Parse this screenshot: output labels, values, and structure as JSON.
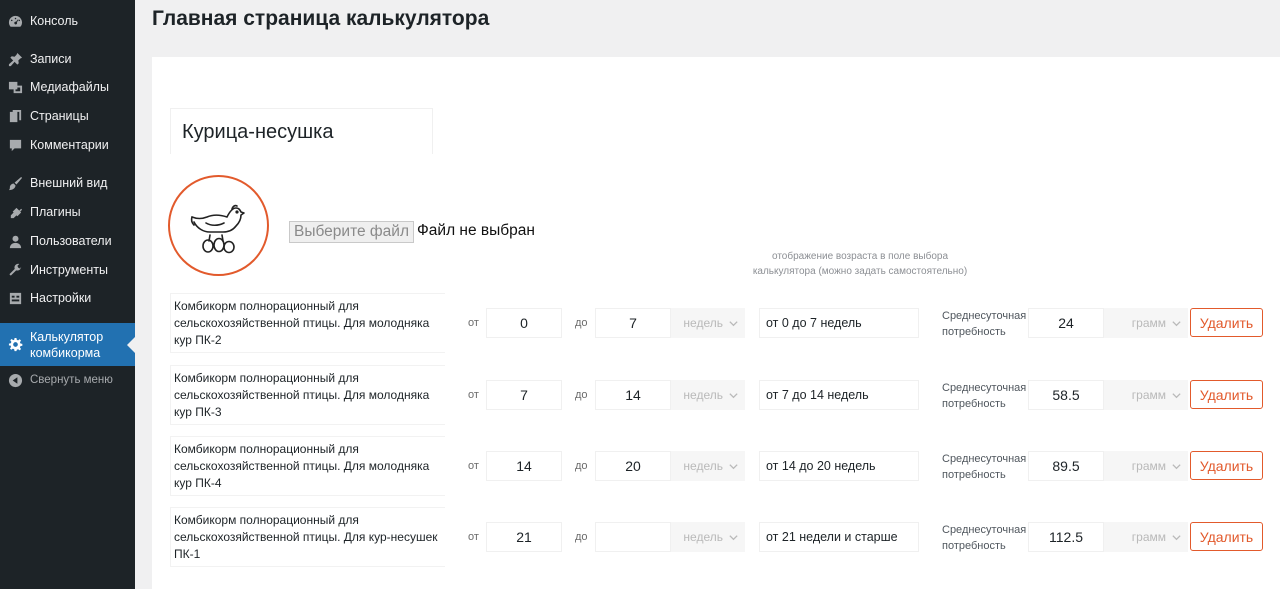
{
  "sidebar": {
    "items": [
      {
        "label": "Консоль",
        "icon": "dashboard-icon"
      },
      {
        "label": "Записи",
        "icon": "pin-icon"
      },
      {
        "label": "Медиафайлы",
        "icon": "media-icon"
      },
      {
        "label": "Страницы",
        "icon": "pages-icon"
      },
      {
        "label": "Комментарии",
        "icon": "comment-icon"
      },
      {
        "label": "Внешний вид",
        "icon": "appearance-icon"
      },
      {
        "label": "Плагины",
        "icon": "plugins-icon"
      },
      {
        "label": "Пользователи",
        "icon": "users-icon"
      },
      {
        "label": "Инструменты",
        "icon": "tools-icon"
      },
      {
        "label": "Настройки",
        "icon": "settings-icon"
      },
      {
        "label": "Калькулятор комбикорма",
        "icon": "gear-icon",
        "active": true
      },
      {
        "label": "Свернуть меню",
        "icon": "collapse-icon"
      }
    ]
  },
  "page": {
    "title": "Главная страница калькулятора",
    "product_name": "Курица-несушка",
    "file_button": "Выберите файл",
    "file_status": "Файл не выбран",
    "age_hint_line1": "отображение возраста в поле выбора",
    "age_hint_line2": "калькулятора (можно задать самостоятельно)"
  },
  "labels": {
    "from": "от",
    "to": "до",
    "unit_weeks": "недель",
    "need_line1": "Среднесуточная",
    "need_line2": "потребность",
    "unit_grams": "грамм",
    "delete": "Удалить"
  },
  "rows": [
    {
      "name": "Комбикорм полнорационный для сельскохозяйственной птицы. Для молодняка кур ПК-2",
      "from": "0",
      "to": "7",
      "range": "от 0 до 7 недель",
      "need": "24"
    },
    {
      "name": "Комбикорм полнорационный для сельскохозяйственной птицы. Для молодняка кур ПК-3",
      "from": "7",
      "to": "14",
      "range": "от 7 до 14 недель",
      "need": "58.5"
    },
    {
      "name": "Комбикорм полнорационный для сельскохозяйственной птицы. Для молодняка кур ПК-4",
      "from": "14",
      "to": "20",
      "range": "от 14 до 20 недель",
      "need": "89.5"
    },
    {
      "name": "Комбикорм полнорационный для сельскохозяйственной птицы. Для кур-несушек ПК-1",
      "from": "21",
      "to": "",
      "range": "от 21 недели и старше",
      "need": "112.5"
    }
  ],
  "colors": {
    "sidebar_bg": "#1d2327",
    "active_item": "#2271b1",
    "accent": "#e25a2c"
  }
}
